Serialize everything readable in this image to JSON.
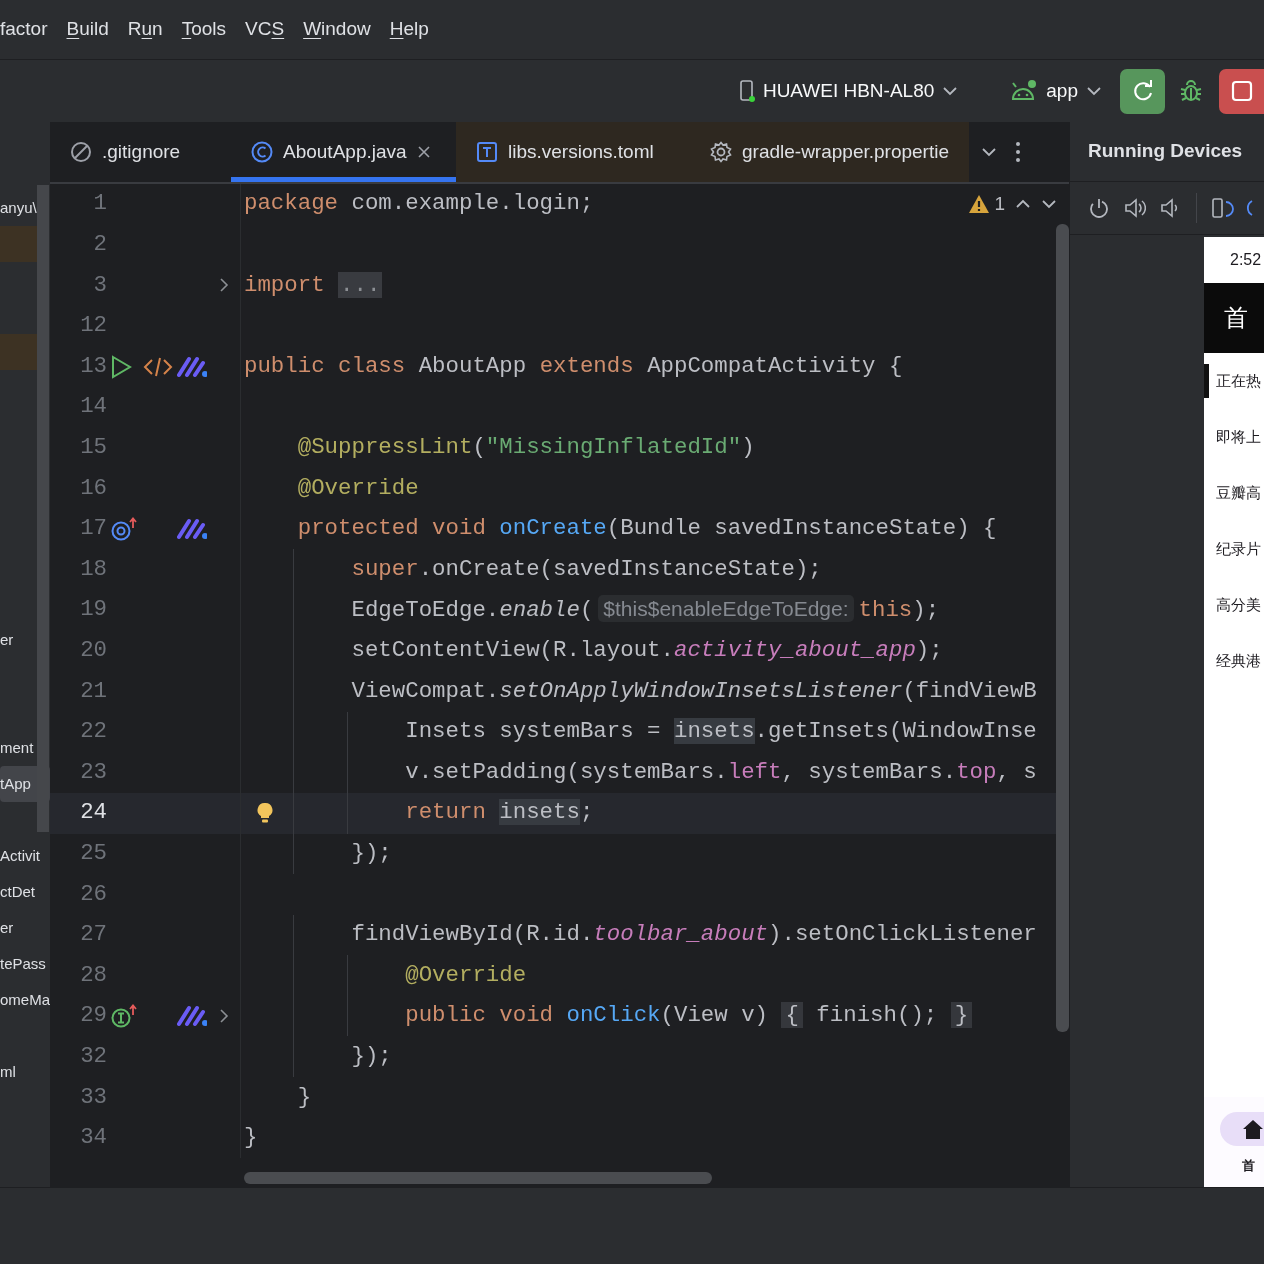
{
  "menu": [
    {
      "label": "factor"
    },
    {
      "key": "B",
      "tail": "uild"
    },
    {
      "head": "R",
      "key": "u",
      "tail": "n"
    },
    {
      "key": "T",
      "tail": "ools"
    },
    {
      "head": "VC",
      "key": "S"
    },
    {
      "key": "W",
      "tail": "indow"
    },
    {
      "key": "H",
      "tail": "elp"
    }
  ],
  "toolbar": {
    "device": "HUAWEI HBN-AL80",
    "config": "app"
  },
  "project": {
    "rows": [
      {
        "kind": "file",
        "label": "anyu\\",
        "tinted": false,
        "selected": false
      },
      {
        "kind": "blank",
        "tinted": true,
        "selected": false
      },
      {
        "kind": "blank",
        "tinted": false,
        "selected": false
      },
      {
        "kind": "blank",
        "tinted": false,
        "selected": false
      },
      {
        "kind": "blank",
        "tinted": true,
        "selected": false
      },
      {
        "kind": "blank",
        "tinted": false,
        "selected": false
      },
      {
        "kind": "blank",
        "tinted": false,
        "selected": false
      },
      {
        "kind": "blank",
        "tinted": false,
        "selected": false
      },
      {
        "kind": "blank",
        "tinted": false,
        "selected": false
      },
      {
        "kind": "blank",
        "tinted": false,
        "selected": false
      },
      {
        "kind": "blank",
        "tinted": false,
        "selected": false
      },
      {
        "kind": "blank",
        "tinted": false,
        "selected": false
      },
      {
        "kind": "file",
        "label": "er",
        "tinted": false,
        "selected": false
      },
      {
        "kind": "blank",
        "tinted": false,
        "selected": false
      },
      {
        "kind": "blank",
        "tinted": false,
        "selected": false
      },
      {
        "kind": "file",
        "label": "ment",
        "tinted": false,
        "selected": false
      },
      {
        "kind": "file",
        "label": "tApp",
        "tinted": false,
        "selected": true
      },
      {
        "kind": "blank",
        "tinted": false,
        "selected": false
      },
      {
        "kind": "file",
        "label": "Activit",
        "tinted": false,
        "selected": false
      },
      {
        "kind": "file",
        "label": "ctDet",
        "tinted": false,
        "selected": false
      },
      {
        "kind": "file",
        "label": "er",
        "tinted": false,
        "selected": false
      },
      {
        "kind": "file",
        "label": "tePass",
        "tinted": false,
        "selected": false
      },
      {
        "kind": "file",
        "label": "omeMa",
        "tinted": false,
        "selected": false
      },
      {
        "kind": "blank",
        "tinted": false,
        "selected": false
      },
      {
        "kind": "file",
        "label": "ml",
        "tinted": false,
        "selected": false
      }
    ]
  },
  "tabs": [
    {
      "kind": "ignore",
      "label": ".gitignore",
      "selected": false,
      "tinted": false
    },
    {
      "kind": "class",
      "label": "AboutApp.java",
      "selected": true,
      "tinted": false
    },
    {
      "kind": "toml",
      "label": "libs.versions.toml",
      "selected": false,
      "tinted": true
    },
    {
      "kind": "settings",
      "label": "gradle-wrapper.propertie",
      "selected": false,
      "tinted": true
    }
  ],
  "editor": {
    "warnings": "1",
    "lines": [
      {
        "n": "1",
        "current": false,
        "tokens": [
          {
            "kind": "kw",
            "text": "package"
          },
          {
            "kind": "plain",
            "text": " com.example.login;"
          }
        ]
      },
      {
        "n": "2",
        "current": false
      },
      {
        "n": "3",
        "current": false,
        "fold": true,
        "tokens": [
          {
            "kind": "kw",
            "text": "import "
          },
          {
            "kind": "fold",
            "text": "..."
          }
        ]
      },
      {
        "n": "12",
        "current": false
      },
      {
        "n": "13",
        "current": false,
        "gutter": [
          {
            "kind": "run"
          },
          {
            "kind": "code"
          },
          {
            "kind": "plugin"
          }
        ],
        "tokens": [
          {
            "kind": "kw",
            "text": "public class "
          },
          {
            "kind": "plain",
            "text": "AboutApp "
          },
          {
            "kind": "kw",
            "text": "extends "
          },
          {
            "kind": "plain",
            "text": "AppCompatActivity {"
          }
        ]
      },
      {
        "n": "14",
        "current": false
      },
      {
        "n": "15",
        "current": false,
        "tokens": [
          {
            "kind": "ann",
            "text": "    @SuppressLint"
          },
          {
            "kind": "plain",
            "text": "("
          },
          {
            "kind": "str",
            "text": "\"MissingInflatedId\""
          },
          {
            "kind": "plain",
            "text": ")"
          }
        ]
      },
      {
        "n": "16",
        "current": false,
        "tokens": [
          {
            "kind": "ann",
            "text": "    @Override"
          }
        ]
      },
      {
        "n": "17",
        "current": false,
        "gutter": [
          {
            "kind": "override"
          },
          {
            "kind": "plugin"
          }
        ],
        "tokens": [
          {
            "kind": "kw",
            "text": "    protected void "
          },
          {
            "kind": "fn",
            "text": "onCreate"
          },
          {
            "kind": "plain",
            "text": "(Bundle savedInstanceState) {"
          }
        ]
      },
      {
        "n": "18",
        "current": false,
        "tokens": [
          {
            "kind": "kw",
            "text": "        super"
          },
          {
            "kind": "plain",
            "text": ".onCreate(savedInstanceState);"
          }
        ]
      },
      {
        "n": "19",
        "current": false,
        "tokens": [
          {
            "kind": "plain",
            "text": "        EdgeToEdge."
          },
          {
            "kind": "ital",
            "text": "enable"
          },
          {
            "kind": "plain",
            "text": "("
          },
          {
            "kind": "hint",
            "text": "$this$enableEdgeToEdge:"
          },
          {
            "kind": "kw",
            "text": "this"
          },
          {
            "kind": "plain",
            "text": ");"
          }
        ]
      },
      {
        "n": "20",
        "current": false,
        "tokens": [
          {
            "kind": "plain",
            "text": "        setContentView(R.layout."
          },
          {
            "kind": "field",
            "text": "activity_about_app"
          },
          {
            "kind": "plain",
            "text": ");"
          }
        ]
      },
      {
        "n": "21",
        "current": false,
        "tokens": [
          {
            "kind": "plain",
            "text": "        ViewCompat."
          },
          {
            "kind": "ital",
            "text": "setOnApplyWindowInsetsListener"
          },
          {
            "kind": "plain",
            "text": "(findViewB"
          }
        ]
      },
      {
        "n": "22",
        "current": false,
        "tokens": [
          {
            "kind": "plain",
            "text": "            Insets systemBars = "
          },
          {
            "kind": "usage",
            "text": "insets"
          },
          {
            "kind": "plain",
            "text": ".getInsets(WindowInse"
          }
        ]
      },
      {
        "n": "23",
        "current": false,
        "tokens": [
          {
            "kind": "plain",
            "text": "            v.setPadding(systemBars."
          },
          {
            "kind": "prop",
            "text": "left"
          },
          {
            "kind": "plain",
            "text": ", systemBars."
          },
          {
            "kind": "prop",
            "text": "top"
          },
          {
            "kind": "plain",
            "text": ", s"
          }
        ]
      },
      {
        "n": "24",
        "current": true,
        "bulb": true,
        "tokens": [
          {
            "kind": "kw",
            "text": "            return "
          },
          {
            "kind": "usage",
            "text": "insets"
          },
          {
            "kind": "plain",
            "text": ";"
          }
        ]
      },
      {
        "n": "25",
        "current": false,
        "tokens": [
          {
            "kind": "plain",
            "text": "        });"
          }
        ]
      },
      {
        "n": "26",
        "current": false
      },
      {
        "n": "27",
        "current": false,
        "tokens": [
          {
            "kind": "plain",
            "text": "        findViewById(R.id."
          },
          {
            "kind": "field",
            "text": "toolbar_about"
          },
          {
            "kind": "plain",
            "text": ").setOnClickListener"
          }
        ]
      },
      {
        "n": "28",
        "current": false,
        "tokens": [
          {
            "kind": "ann",
            "text": "            @Override"
          }
        ]
      },
      {
        "n": "29",
        "current": false,
        "fold": true,
        "gutter": [
          {
            "kind": "implement"
          },
          {
            "kind": "plugin"
          }
        ],
        "tokens": [
          {
            "kind": "kw",
            "text": "            public void "
          },
          {
            "kind": "fn",
            "text": "onClick"
          },
          {
            "kind": "plain",
            "text": "(View v) "
          },
          {
            "kind": "brace",
            "text": "{"
          },
          {
            "kind": "plain",
            "text": " finish(); "
          },
          {
            "kind": "brace",
            "text": "}"
          }
        ]
      },
      {
        "n": "32",
        "current": false,
        "tokens": [
          {
            "kind": "plain",
            "text": "        });"
          }
        ]
      },
      {
        "n": "33",
        "current": false,
        "tokens": [
          {
            "kind": "plain",
            "text": "    }"
          }
        ]
      },
      {
        "n": "34",
        "current": false,
        "tokens": [
          {
            "kind": "plain",
            "text": "}"
          }
        ]
      }
    ]
  },
  "running_devices": {
    "title": "Running Devices",
    "phone": {
      "time": "2:52",
      "header": "首",
      "nav_label": "首",
      "items": [
        {
          "label": "正在热",
          "selected": true
        },
        {
          "label": "即将上",
          "selected": false
        },
        {
          "label": "豆瓣高",
          "selected": false
        },
        {
          "label": "纪录片",
          "selected": false
        },
        {
          "label": "高分美",
          "selected": false
        },
        {
          "label": "经典港",
          "selected": false
        }
      ]
    }
  }
}
